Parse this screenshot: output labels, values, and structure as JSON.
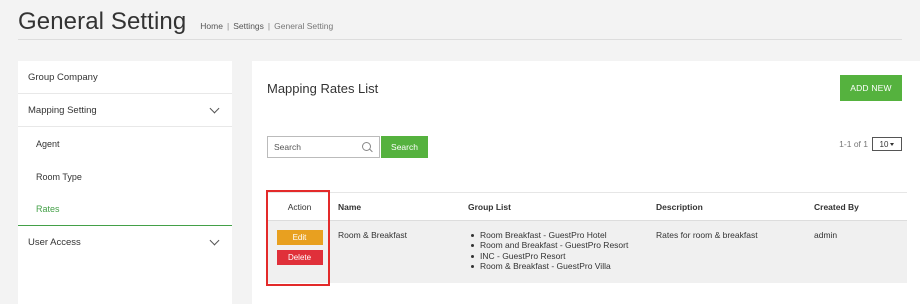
{
  "header": {
    "title": "General Setting",
    "breadcrumb": [
      "Home",
      "Settings",
      "General Setting"
    ],
    "separator": "|"
  },
  "sidebar": {
    "group_company": "Group Company",
    "mapping_setting": "Mapping Setting",
    "sub_items": [
      "Agent",
      "Room Type",
      "Rates"
    ],
    "active_sub": "Rates",
    "user_access": "User Access"
  },
  "main": {
    "title": "Mapping Rates List",
    "add_new_label": "ADD NEW",
    "search_placeholder": "Search",
    "search_button": "Search",
    "pager_text": "1-1 of 1",
    "page_size": "10"
  },
  "table": {
    "columns": [
      "Action",
      "Name",
      "Group List",
      "Description",
      "Created By"
    ],
    "rows": [
      {
        "actions": [
          "Edit",
          "Delete"
        ],
        "name": "Room & Breakfast",
        "group_list": [
          "Room Breakfast - GuestPro Hotel",
          "Room and Breakfast - GuestPro Resort",
          "INC - GuestPro Resort",
          "Room & Breakfast - GuestPro Villa"
        ],
        "description": "Rates for room & breakfast",
        "created_by": "admin"
      }
    ]
  },
  "colors": {
    "accent_green": "#55b23e",
    "edit_orange": "#e8a020",
    "delete_red": "#e0303a",
    "highlight_red": "#e32a2a"
  }
}
